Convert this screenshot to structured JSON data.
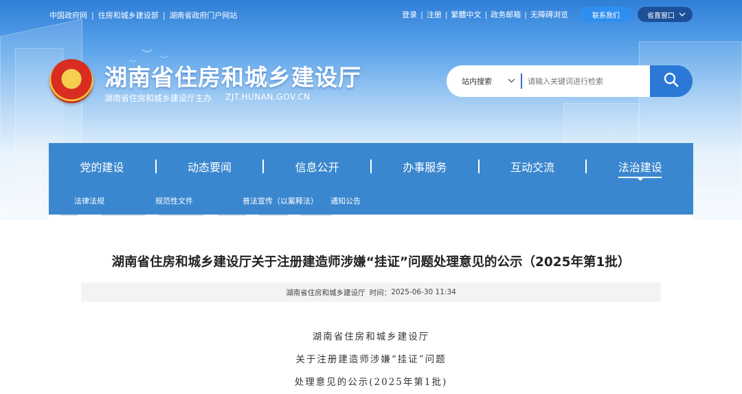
{
  "top_links": {
    "left": [
      "中国政府网",
      "住房和城乡建设部",
      "湖南省政府门户网站"
    ],
    "right": [
      "登录",
      "注册",
      "繁體中文",
      "政务邮箱",
      "无障碍浏览"
    ],
    "contact_button": "联系我们",
    "province_window": "省直窗口"
  },
  "header": {
    "site_title": "湖南省住房和城乡建设厅",
    "sponsor": "湖南省住房和城乡建设厅主办",
    "domain": "ZJT.HUNAN.GOV.CN"
  },
  "search": {
    "scope": "站内搜索",
    "placeholder": "请输入关键词进行检索"
  },
  "nav": {
    "items": [
      "党的建设",
      "动态要闻",
      "信息公开",
      "办事服务",
      "互动交流",
      "法治建设"
    ],
    "active_index": 5,
    "sub_items": [
      "法律法规",
      "规范性文件",
      "普法宣传（以案释法）",
      "通知公告"
    ]
  },
  "article": {
    "title": "湖南省住房和城乡建设厅关于注册建造师涉嫌“挂证”问题处理意见的公示（2025年第1批）",
    "source": "湖南省住房和城乡建设厅",
    "time_label": "时间：",
    "time": "2025-06-30 11:34",
    "body_lines": [
      "湖南省住房和城乡建设厅",
      "关于注册建造师涉嫌“挂证”问题",
      "处理意见的公示(2025年第1批)"
    ]
  },
  "colors": {
    "nav_bg": "#3a87cf",
    "search_button": "#2b78d6",
    "contact_pill": "#2f8ff0",
    "window_pill": "#1c4f97"
  }
}
